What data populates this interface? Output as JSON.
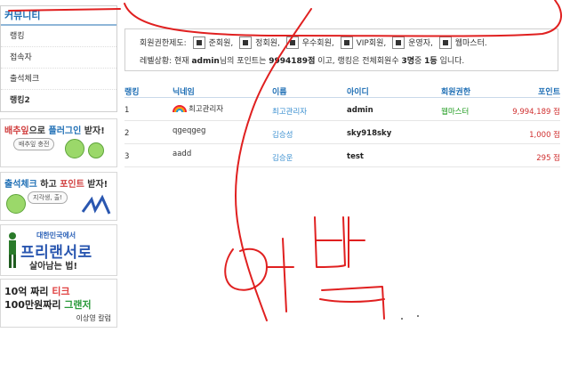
{
  "sidebar": {
    "title": "커뮤니티",
    "items": [
      {
        "label": "랭킹"
      },
      {
        "label": "접속자"
      },
      {
        "label": "출석체크"
      },
      {
        "label": "랭킹2"
      }
    ]
  },
  "banners": {
    "b1": {
      "part1": "배추잎",
      "part2": "으로 ",
      "part3": "플러그인",
      "part4": " 받자!",
      "pill": "배추잎 충전"
    },
    "b2": {
      "part1": "출석체크",
      "part2": " 하고 ",
      "part3": "포인트",
      "part4": " 받자!",
      "pill": "지각생, 출!"
    },
    "b3": {
      "line1": "대한민국에서",
      "line2": "프리랜서로",
      "line3": "살아남는 법!"
    },
    "b4": {
      "line1a": "10억 짜리 ",
      "line1b": "티크",
      "line2a": "100만원짜리 ",
      "line2b": "그랜저",
      "line3": "이상영 칼럼"
    }
  },
  "info": {
    "label": "회원권한제도:",
    "levels": [
      "준회원,",
      "정회원,",
      "우수회원,",
      "VIP회원,",
      "운영자,",
      "웹마스터."
    ],
    "status_prefix": "레벨상황: 현재 ",
    "user": "admin",
    "mid1": "님의 포인트는 ",
    "points": "9994189점",
    "mid2": " 이고, 랭킹은 전체회원수 ",
    "member_count": "3명",
    "mid3": "중 ",
    "rank": "1등",
    "suffix": " 입니다."
  },
  "table": {
    "headers": {
      "rank": "랭킹",
      "nick": "닉네임",
      "name": "이름",
      "id": "아이디",
      "perm": "회원권한",
      "point": "포인트"
    },
    "rows": [
      {
        "rank": "1",
        "nick": "최고관리자",
        "name": "최고관리자",
        "id": "admin",
        "perm": "웹마스터",
        "point": "9,994,189 점"
      },
      {
        "rank": "2",
        "nick": "qgeqgeg",
        "name": "김승성",
        "id": "sky918sky",
        "perm": "",
        "point": "1,000 점"
      },
      {
        "rank": "3",
        "nick": "aadd",
        "name": "김승운",
        "id": "test",
        "perm": "",
        "point": "295 점"
      }
    ]
  },
  "colors": {
    "accent": "#1f6fb5",
    "scribble": "#e02020",
    "point": "#d03030",
    "perm": "#1c9a1c"
  }
}
